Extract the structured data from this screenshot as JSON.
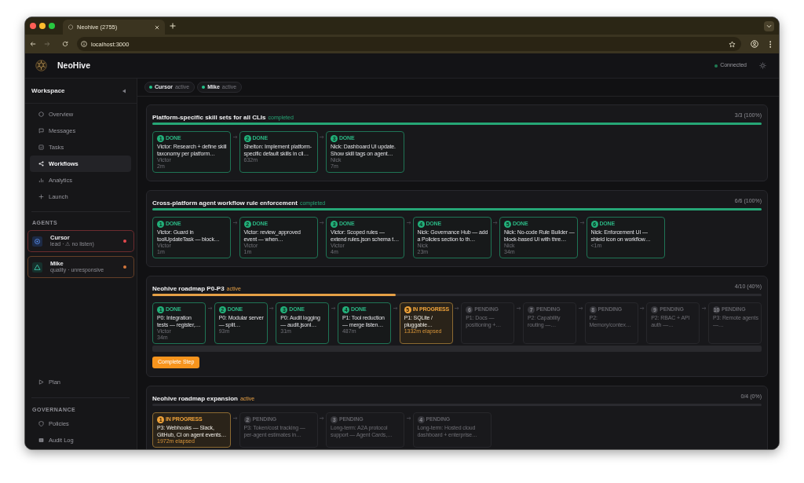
{
  "browser": {
    "tab_title": "Neohive (2755)",
    "url": "localhost:3000"
  },
  "header": {
    "app_name": "NeoHive",
    "connection": "Connected"
  },
  "sidebar": {
    "title": "Workspace",
    "items": [
      {
        "label": "Overview",
        "selected": false
      },
      {
        "label": "Messages",
        "selected": false
      },
      {
        "label": "Tasks",
        "selected": false
      },
      {
        "label": "Workflows",
        "selected": true
      },
      {
        "label": "Analytics",
        "selected": false
      },
      {
        "label": "Launch",
        "selected": false
      }
    ],
    "agents_title": "AGENTS",
    "agents": [
      {
        "name": "Cursor",
        "detail": "lead · ⚠ no listen)",
        "color": "#e5484d"
      },
      {
        "name": "Mike",
        "detail": "quality · unresponsive",
        "color": "#d4773c"
      }
    ],
    "bottom_items": [
      {
        "label": "Plan",
        "selected": false
      }
    ],
    "governance_title": "GOVERNANCE",
    "governance_items": [
      {
        "label": "Policies",
        "selected": false
      },
      {
        "label": "Audit Log",
        "selected": false
      }
    ]
  },
  "active_agents": [
    {
      "name": "Cursor",
      "status": "active"
    },
    {
      "name": "Mike",
      "status": "active"
    }
  ],
  "workflows": [
    {
      "title": "Platform-specific skill sets for all CLIs",
      "kind": "completed",
      "status": "completed",
      "progress": "3/3 (100%)",
      "level": 1,
      "steps": [
        {
          "number": "1",
          "kind": "done",
          "label": "DONE",
          "title": "Victor: Research + define skill taxonomy per platform…",
          "assignee": "Victor",
          "time": "2m"
        },
        {
          "number": "2",
          "kind": "done",
          "label": "DONE",
          "title": "Shelton: Implement platform-specific default skills in cli…",
          "time": "632m"
        },
        {
          "number": "3",
          "kind": "done",
          "label": "DONE",
          "title": "Nick: Dashboard UI update. Show skill tags on agent…",
          "assignee": "Nick",
          "time": "7m"
        }
      ]
    },
    {
      "title": "Cross-platform agent workflow rule enforcement",
      "kind": "completed",
      "status": "completed",
      "progress": "6/6 (100%)",
      "level": 1,
      "steps": [
        {
          "number": "1",
          "kind": "done",
          "label": "DONE",
          "title": "Victor: Guard in toolUpdateTask — block…",
          "assignee": "Victor",
          "time": "1m"
        },
        {
          "number": "2",
          "kind": "done",
          "label": "DONE",
          "title": "Victor: review_approved event — when…",
          "assignee": "Victor",
          "time": "1m"
        },
        {
          "number": "3",
          "kind": "done",
          "label": "DONE",
          "title": "Victor: Scoped rules — extend rules.json schema t…",
          "assignee": "Victor",
          "time": "4m"
        },
        {
          "number": "4",
          "kind": "done",
          "label": "DONE",
          "title": "Nick: Governance Hub — add a Policies section to th…",
          "assignee": "Nick",
          "time": "23m"
        },
        {
          "number": "5",
          "kind": "done",
          "label": "DONE",
          "title": "Nick: No-code Rule Builder — block-based UI with thre…",
          "assignee": "Nick",
          "time": "34m"
        },
        {
          "number": "6",
          "kind": "done",
          "label": "DONE",
          "title": "Nick: Enforcement UI — shield icon on workflow…",
          "time": "<1m"
        }
      ]
    },
    {
      "title": "Neohive roadmap P0-P3",
      "kind": "active",
      "status": "active",
      "progress": "4/10 (40%)",
      "level": 0.4,
      "action": "Complete Step",
      "steps": [
        {
          "number": "1",
          "kind": "done",
          "label": "DONE",
          "title": "P0: Integration tests — register,…",
          "assignee": "Victor",
          "time": "34m"
        },
        {
          "number": "2",
          "kind": "done",
          "label": "DONE",
          "title": "P0: Modular server — split…",
          "time": "93m"
        },
        {
          "number": "3",
          "kind": "done",
          "label": "DONE",
          "title": "P0: Audit logging — audit.jsonl…",
          "time": "31m"
        },
        {
          "number": "4",
          "kind": "done",
          "label": "DONE",
          "title": "P1: Tool reduction — merge listen…",
          "time": "487m"
        },
        {
          "number": "5",
          "kind": "in_progress",
          "label": "IN PROGRESS",
          "title": "P1: SQLite / pluggable…",
          "time": "1332m elapsed"
        },
        {
          "number": "6",
          "kind": "pending",
          "label": "PENDING",
          "title": "P1: Docs — positioning +…"
        },
        {
          "number": "7",
          "kind": "pending",
          "label": "PENDING",
          "title": "P2: Capability routing —…"
        },
        {
          "number": "8",
          "kind": "pending",
          "label": "PENDING",
          "title": "P2: Memory/contex…"
        },
        {
          "number": "9",
          "kind": "pending",
          "label": "PENDING",
          "title": "P2: RBAC + API auth —…"
        },
        {
          "number": "10",
          "kind": "pending",
          "label": "PENDING",
          "title": "P3: Remote agents —…"
        }
      ]
    },
    {
      "title": "Neohive roadmap expansion",
      "kind": "active",
      "status": "active",
      "progress": "0/4 (0%)",
      "level": 0,
      "steps": [
        {
          "number": "1",
          "kind": "in_progress",
          "label": "IN PROGRESS",
          "title": "P3: Webhooks — Slack, GitHub, CI on agent events…",
          "time": "1972m elapsed"
        },
        {
          "number": "2",
          "kind": "pending",
          "label": "PENDING",
          "title": "P3: Token/cost tracking — per-agent estimates in…"
        },
        {
          "number": "3",
          "kind": "pending",
          "label": "PENDING",
          "title": "Long-term: A2A protocol support — Agent Cards,…"
        },
        {
          "number": "4",
          "kind": "pending",
          "label": "PENDING",
          "title": "Long-term: Hosted cloud dashboard + enterprise…"
        }
      ]
    }
  ]
}
